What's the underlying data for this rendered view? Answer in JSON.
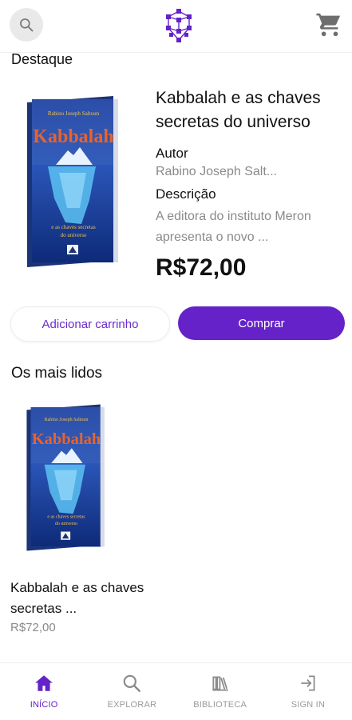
{
  "header": {
    "search_icon": "search-icon",
    "logo_icon": "hexagon-network-logo",
    "cart_icon": "cart-icon",
    "accent_color": "#6422c8"
  },
  "featured": {
    "section_title": "Destaque",
    "title": "Kabbalah  e as chaves secretas do universo",
    "author_label": "Autor",
    "author": "Rabino Joseph Salt...",
    "description_label": "Descrição",
    "description": "A editora do instituto Meron apresenta o novo ...",
    "price": "R$72,00",
    "cover": {
      "author_text": "Rabino Joseph Saltoun",
      "book_title": "Kabbalah",
      "subtitle_line1": "e as chaves secretas",
      "subtitle_line2": "do universo"
    },
    "add_cart_label": "Adicionar carrinho",
    "buy_label": "Comprar"
  },
  "most_read": {
    "section_title": "Os mais lidos",
    "items": [
      {
        "title": "Kabbalah  e as chaves secretas ...",
        "price": "R$72,00",
        "cover": {
          "author_text": "Rabino Joseph Saltoun",
          "book_title": "Kabbalah",
          "subtitle_line1": "e as chaves secretas",
          "subtitle_line2": "do universo"
        }
      }
    ]
  },
  "nav": {
    "items": [
      {
        "label": "INÍCIO",
        "icon": "home-icon",
        "active": true
      },
      {
        "label": "EXPLORAR",
        "icon": "search-icon",
        "active": false
      },
      {
        "label": "BIBLIOTECA",
        "icon": "library-icon",
        "active": false
      },
      {
        "label": "SIGN IN",
        "icon": "sign-in-icon",
        "active": false
      }
    ]
  }
}
